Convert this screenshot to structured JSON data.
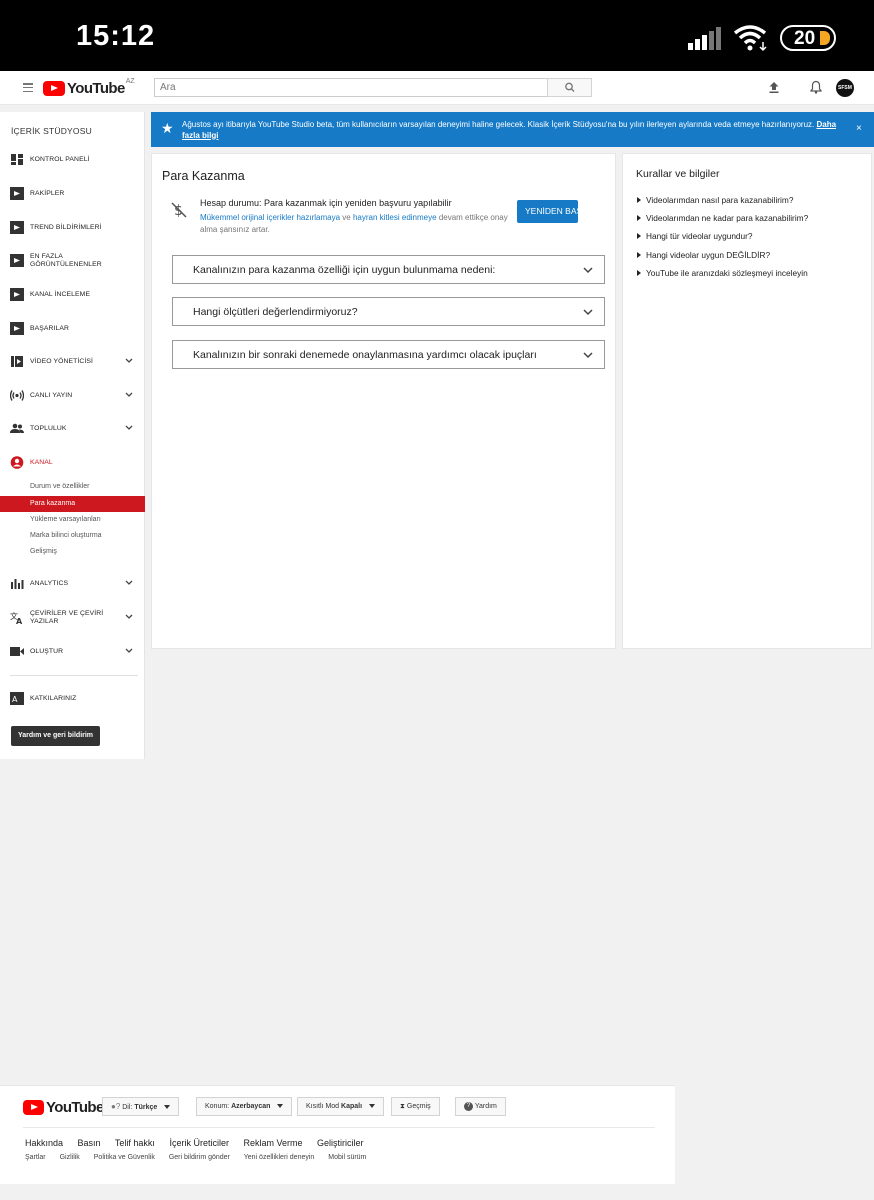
{
  "status_bar": {
    "time": "15:12",
    "battery_level": "20",
    "battery_color": "#f5a623"
  },
  "masthead": {
    "logo_text": "YouTube",
    "country_code": "AZ",
    "search_placeholder": "Ara",
    "avatar_text": "SFSM"
  },
  "sidebar": {
    "title": "İÇERİK STÜDYOSU",
    "items": [
      {
        "label": "KONTROL PANELİ",
        "icon": "dashboard-icon"
      },
      {
        "label": "RAKİPLER",
        "icon": "competitors-icon"
      },
      {
        "label": "TREND BİLDİRİMLERİ",
        "icon": "trend-icon"
      },
      {
        "label": "EN FAZLA GÖRÜNTÜLENENLER",
        "icon": "most-viewed-icon"
      },
      {
        "label": "KANAL İNCELEME",
        "icon": "channel-review-icon"
      },
      {
        "label": "BAŞARILAR",
        "icon": "achievements-icon"
      },
      {
        "label": "VİDEO YÖNETİCİSİ",
        "icon": "video-manager-icon"
      },
      {
        "label": "CANLI YAYIN",
        "icon": "live-stream-icon"
      },
      {
        "label": "TOPLULUK",
        "icon": "community-icon"
      },
      {
        "label": "KANAL",
        "icon": "channel-icon"
      },
      {
        "label": "ANALYTICS",
        "icon": "analytics-icon"
      },
      {
        "label": "ÇEVİRİLER VE ÇEVİRİ YAZILAR",
        "icon": "translate-icon"
      },
      {
        "label": "OLUŞTUR",
        "icon": "create-icon"
      },
      {
        "label": "KATKILARINIZ",
        "icon": "contributions-icon"
      }
    ],
    "channel_sub": [
      "Durum ve özellikler",
      "Para kazanma",
      "Yükleme varsayılanları",
      "Marka bilinci oluşturma",
      "Gelişmiş"
    ],
    "help_button": "Yardım ve geri bildirim",
    "accent_color": "#cc181e"
  },
  "banner": {
    "text": "Ağustos ayı itibarıyla YouTube Studio beta, tüm kullanıcıların varsayılan deneyimi haline gelecek. Klasik İçerik Stüdyosu'na bu yılın ilerleyen aylarında veda etmeye hazırlanıyoruz.",
    "link": "Daha fazla bilgi",
    "close": "×",
    "color": "#167ac6"
  },
  "main": {
    "title": "Para Kazanma",
    "status_line": "Hesap durumu: Para kazanmak için yeniden başvuru yapılabilir",
    "desc_link1": "Mükemmel orijinal içerikler hazırlamaya",
    "desc_and": "ve",
    "desc_link2": "hayran kitlesi edinmeye",
    "desc_rest": "devam ettikçe onay alma şansınız artar.",
    "reapply_button": "YENİDEN BAŞVUR",
    "accordions": [
      "Kanalınızın para kazanma özelliği için uygun bulunmama nedeni:",
      "Hangi ölçütleri değerlendirmiyoruz?",
      "Kanalınızın bir sonraki denemede onaylanmasına yardımcı olacak ipuçları"
    ]
  },
  "rules": {
    "title": "Kurallar ve bilgiler",
    "items": [
      "Videolarımdan nasıl para kazanabilirim?",
      "Videolarımdan ne kadar para kazanabilirim?",
      "Hangi tür videolar uygundur?",
      "Hangi videolar uygun DEĞİLDİR?",
      "YouTube ile aranızdaki sözleşmeyi inceleyin"
    ]
  },
  "footer": {
    "logo_text": "YouTube",
    "language_label": "Dil:",
    "language_value": "Türkçe",
    "location_label": "Konum:",
    "location_value": "Azerbaycan",
    "restricted_label": "Kısıtlı Mod",
    "restricted_value": "Kapalı",
    "history": "Geçmiş",
    "help": "Yardım",
    "links": [
      "Hakkında",
      "Basın",
      "Telif hakkı",
      "İçerik Üreticiler",
      "Reklam Verme",
      "Geliştiriciler"
    ],
    "links2": [
      "Şartlar",
      "Gizlilik",
      "Politika ve Güvenlik",
      "Geri bildirim gönder",
      "Yeni özellikleri deneyin",
      "Mobil sürüm"
    ]
  }
}
